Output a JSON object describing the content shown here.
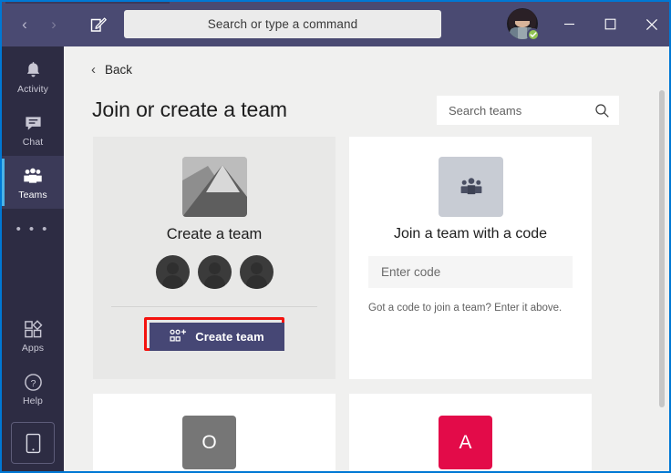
{
  "window": {
    "border_color": "#0078d4",
    "titlebar_color": "#4a4a72",
    "rail_color": "#2d2c43",
    "content_bg": "#f0f0ef"
  },
  "titlebar": {
    "back_arrow": "‹",
    "forward_arrow": "›",
    "compose_icon": "compose-icon",
    "search": {
      "placeholder": "Search or type a command",
      "value": ""
    },
    "avatar": {
      "presence": "Available",
      "presence_color": "#92c353"
    },
    "minimize_label": "—",
    "maximize_label": "☐",
    "close_label": "✕"
  },
  "rail": {
    "items": [
      {
        "id": "activity",
        "label": "Activity",
        "icon": "bell-icon",
        "active": false
      },
      {
        "id": "chat",
        "label": "Chat",
        "icon": "chat-icon",
        "active": false
      },
      {
        "id": "teams",
        "label": "Teams",
        "icon": "people-icon",
        "active": true
      }
    ],
    "more_label": "• • •",
    "bottom_items": [
      {
        "id": "apps",
        "label": "Apps",
        "icon": "apps-icon"
      },
      {
        "id": "help",
        "label": "Help",
        "icon": "help-icon"
      }
    ],
    "mobile_button_icon": "mobile-phone-icon",
    "active_accent": "#4ab3e8"
  },
  "content": {
    "back": {
      "chevron": "‹",
      "label": "Back"
    },
    "title": "Join or create a team",
    "search_teams": {
      "placeholder": "Search teams",
      "value": "",
      "icon": "search-icon"
    },
    "cards": {
      "create_team": {
        "thumbnail_icon": "image-placeholder-icon",
        "heading": "Create a team",
        "avatar_count": 3,
        "button_label": "Create team",
        "button_icon": "add-team-icon",
        "button_color": "#464775",
        "highlight_color": "#f4130f",
        "highlighted": true
      },
      "join_with_code": {
        "thumbnail_icon": "people-group-icon",
        "heading": "Join a team with a code",
        "code_input": {
          "placeholder": "Enter code",
          "value": ""
        },
        "hint": "Got a code to join a team? Enter it above."
      },
      "team_tiles": [
        {
          "initial": "O",
          "color": "#767676"
        },
        {
          "initial": "A",
          "color": "#e30b49"
        }
      ]
    }
  },
  "scrollbar": {
    "orientation": "vertical",
    "thumb_color": "#c6c6c6"
  }
}
